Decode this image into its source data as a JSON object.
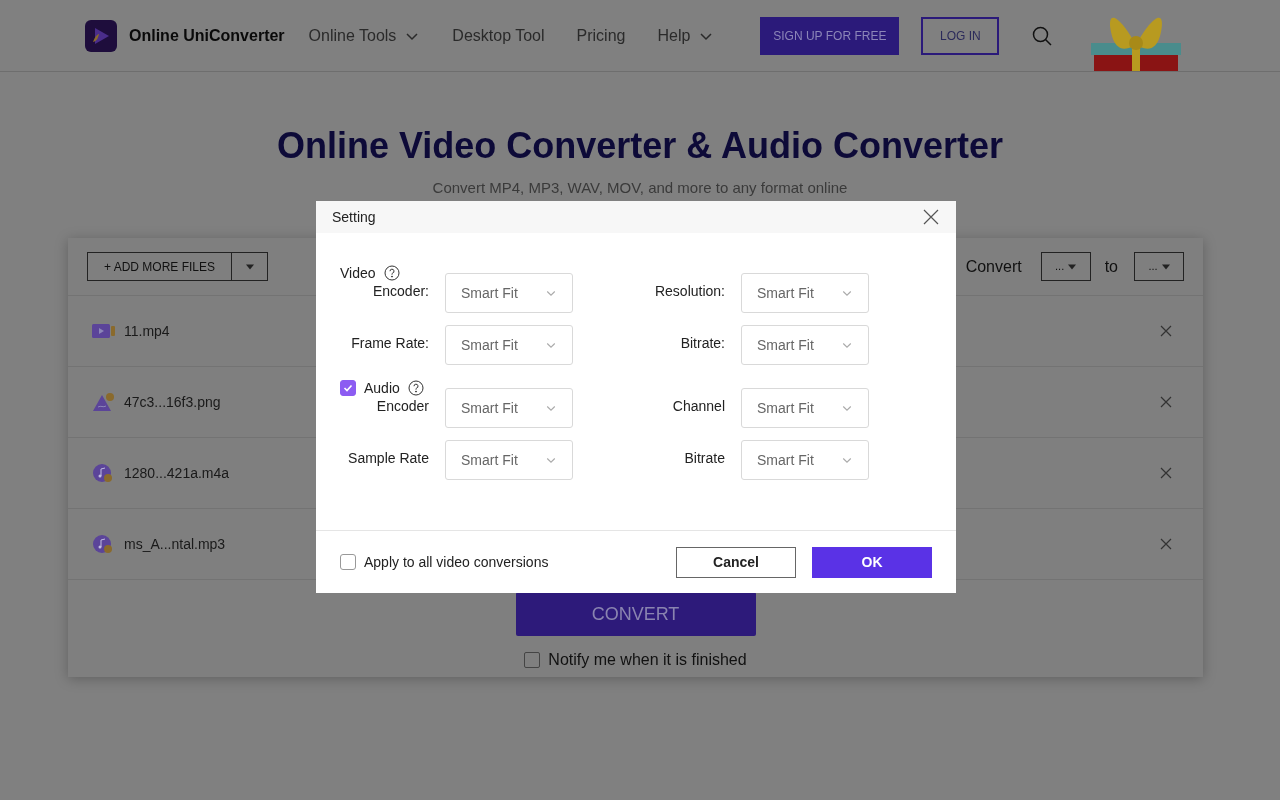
{
  "header": {
    "brand": "Online UniConverter",
    "nav": [
      {
        "label": "Online Tools",
        "dropdown": true
      },
      {
        "label": "Desktop Tool",
        "dropdown": false
      },
      {
        "label": "Pricing",
        "dropdown": false
      },
      {
        "label": "Help",
        "dropdown": true
      }
    ],
    "signup": "SIGN UP FOR FREE",
    "login": "LOG IN"
  },
  "hero": {
    "title": "Online Video Converter & Audio Converter",
    "subtitle": "Convert MP4, MP3, WAV, MOV, and more to any format online"
  },
  "toolbar": {
    "add_button": "+ ADD MORE FILES",
    "convert_label": "Convert",
    "from": "...",
    "to_label": "to",
    "to": "..."
  },
  "files": [
    {
      "name": "11.mp4",
      "kind": "video"
    },
    {
      "name": "47c3...16f3.png",
      "kind": "image"
    },
    {
      "name": "1280...421a.m4a",
      "kind": "audio"
    },
    {
      "name": "ms_A...ntal.mp3",
      "kind": "audio"
    }
  ],
  "convert_button": "CONVERT",
  "notify": {
    "label": "Notify me when it is finished",
    "checked": false
  },
  "dialog": {
    "title": "Setting",
    "sections": [
      {
        "label": "Video",
        "kind": "heading",
        "fields": [
          {
            "label": "Encoder:",
            "value": "Smart Fit"
          },
          {
            "label": "Resolution:",
            "value": "Smart Fit"
          },
          {
            "label": "Frame Rate:",
            "value": "Smart Fit"
          },
          {
            "label": "Bitrate:",
            "value": "Smart Fit"
          }
        ]
      },
      {
        "label": "Audio",
        "kind": "checkbox",
        "checked": true,
        "fields": [
          {
            "label": "Encoder",
            "value": "Smart Fit"
          },
          {
            "label": "Channel",
            "value": "Smart Fit"
          },
          {
            "label": "Sample Rate",
            "value": "Smart Fit"
          },
          {
            "label": "Bitrate",
            "value": "Smart Fit"
          }
        ]
      }
    ],
    "apply_all": {
      "label": "Apply to all video conversions",
      "checked": false
    },
    "cancel": "Cancel",
    "ok": "OK"
  }
}
